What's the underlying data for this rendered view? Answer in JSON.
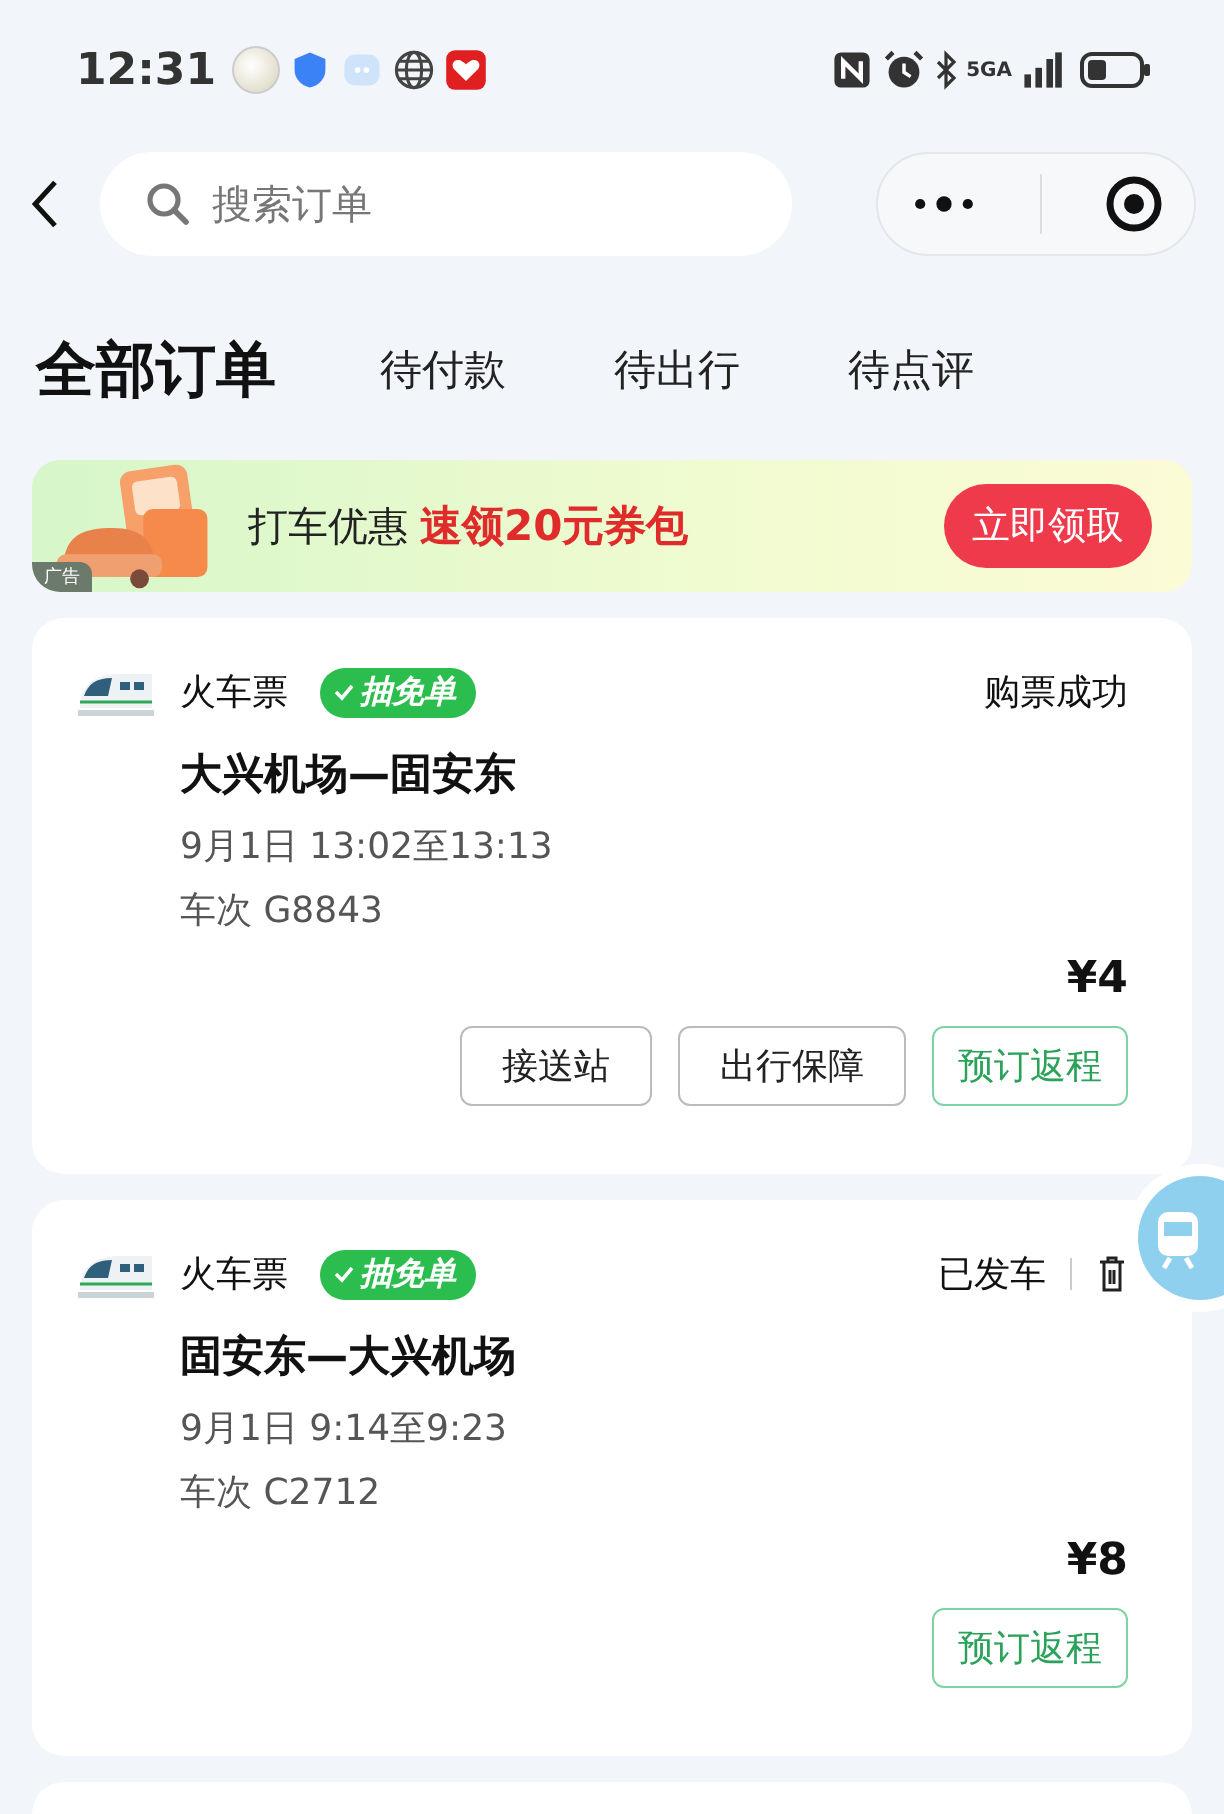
{
  "status_bar": {
    "time": "12:31",
    "network": "5GA"
  },
  "search": {
    "placeholder": "搜索订单"
  },
  "tabs": [
    {
      "label": "全部订单",
      "selected": true
    },
    {
      "label": "待付款",
      "selected": false
    },
    {
      "label": "待出行",
      "selected": false
    },
    {
      "label": "待点评",
      "selected": false
    }
  ],
  "banner": {
    "ad_tag": "广告",
    "lead": "打车优惠",
    "offer": "速领20元券包",
    "button": "立即领取"
  },
  "orders": [
    {
      "category": "火车票",
      "badge": "抽免单",
      "status": "购票成功",
      "deletable": false,
      "route": "大兴机场—固安东",
      "time": "9月1日 13:02至13:13",
      "train": "车次 G8843",
      "price": "¥4",
      "buttons": [
        {
          "label": "接送站",
          "kind": "outline"
        },
        {
          "label": "出行保障",
          "kind": "outline"
        },
        {
          "label": "预订返程",
          "kind": "primary"
        }
      ]
    },
    {
      "category": "火车票",
      "badge": "抽免单",
      "status": "已发车",
      "deletable": true,
      "route": "固安东—大兴机场",
      "time": "9月1日 9:14至9:23",
      "train": "车次 C2712",
      "price": "¥8",
      "buttons": [
        {
          "label": "预订返程",
          "kind": "primary"
        }
      ]
    }
  ]
}
